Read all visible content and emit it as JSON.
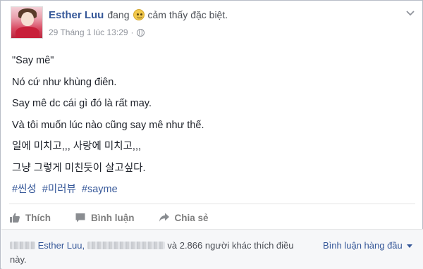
{
  "post": {
    "author": "Esther Luu",
    "feeling_prefix": "đang",
    "feeling_icon": "smiling-face-emoji",
    "feeling_text": "cảm thấy đặc biệt.",
    "timestamp": "29 Tháng 1 lúc 13:29",
    "separator": "·",
    "privacy_icon": "globe-icon",
    "lines": [
      "\"Say mê\"",
      "Nó cứ như khùng điên.",
      "Say mê dc cái gì đó là rất may.",
      "Và tôi muốn lúc nào cũng say mê như thế.",
      "일에 미치고,,, 사랑에 미치고,,,",
      "그냥 그렇게 미친듯이 살고싶다."
    ],
    "hashtags": [
      "#씬성",
      "#미러뷰",
      "#sayme"
    ]
  },
  "actions": {
    "like_label": "Thích",
    "comment_label": "Bình luận",
    "share_label": "Chia sẻ"
  },
  "footer": {
    "liker_name": "Esther Luu,",
    "others_text": "và 2.866 người khác",
    "like_word": "thích điều",
    "end_text": "này.",
    "sort_label": "Bình luận hàng đầu"
  },
  "colors": {
    "link": "#365899",
    "muted": "#90949c",
    "action": "#7f7f7f",
    "footer_bg": "#f6f7f9"
  }
}
